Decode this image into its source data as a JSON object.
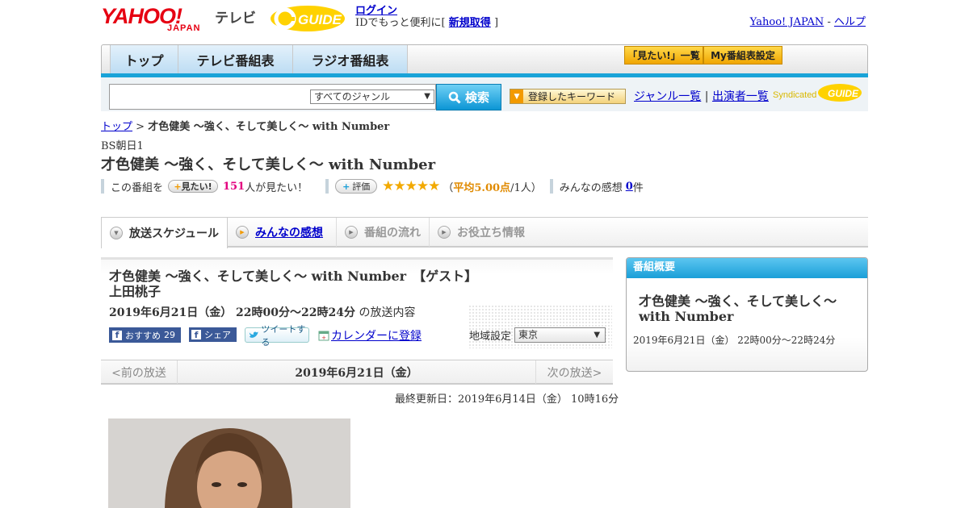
{
  "header": {
    "logo_yahoo": "YAHOO!",
    "logo_japan": "JAPAN",
    "logo_tv": "テレビ",
    "logo_gguide": "GUIDE",
    "login_link": "ログイン",
    "login_note_pre": "IDでもっと便利に[",
    "signup_link": "新規取得",
    "login_note_post": "]",
    "yahoo_japan_link": "Yahoo! JAPAN",
    "separator": "-",
    "help_link": "ヘルプ"
  },
  "nav": {
    "tabs": [
      {
        "label": "トップ"
      },
      {
        "label": "テレビ番組表"
      },
      {
        "label": "ラジオ番組表"
      }
    ],
    "mitai_list": "「見たい!」一覧",
    "my_schedule": "My番組表設定"
  },
  "search": {
    "genre_selected": "すべてのジャンル",
    "button": "検索",
    "keyword_button": "登録したキーワード",
    "genre_list": "ジャンル一覧",
    "link_sep": "|",
    "performers": "出演者一覧",
    "syndicated": "Syndicated"
  },
  "breadcrumb": {
    "top": "トップ",
    "sep": ">",
    "current": "才色健美 ～強く、そして美しく～ with Number"
  },
  "program": {
    "station": "BS朝日1",
    "title": "才色健美 ～強く、そして美しく～ with Number",
    "kono_bangumi": "この番組を",
    "mitai_button": "見たい!",
    "mitai_count": "151",
    "mitai_suffix": "人が見たい！",
    "hyoka_button": "評価",
    "stars": "★★★★★",
    "rating_open": "（",
    "rating_avg": "平均5.00点",
    "rating_count": "/1人）",
    "kansou_label": "みんなの感想",
    "kansou_count": "0",
    "kansou_suffix": "件"
  },
  "subtabs": [
    {
      "label": "放送スケジュール"
    },
    {
      "label": "みんなの感想"
    },
    {
      "label": "番組の流れ"
    },
    {
      "label": "お役立ち情報"
    }
  ],
  "broadcast": {
    "title": "才色健美 ～強く、そして美しく～ with Number　【ゲスト】上田桃子",
    "datetime": "2019年6月21日（金）  22時00分～22時24分",
    "datetime_suffix": "の放送内容",
    "fb_recommend": "おすすめ",
    "fb_recommend_count": "29",
    "fb_share": "シェア",
    "tweet": "ツイートする",
    "calendar": "カレンダーに登録",
    "region_label": "地域設定",
    "region_value": "東京",
    "prev": "<前の放送",
    "date": "2019年6月21日（金）",
    "next": "次の放送>",
    "updated": "最終更新日：2019年6月14日（金）  10時16分"
  },
  "sidebar": {
    "heading": "番組概要",
    "title": "才色健美 ～強く、そして美しく～ with Number",
    "time": "2019年6月21日（金）  22時00分～22時24分"
  },
  "colors": {
    "accent_blue": "#1aa3d8",
    "link": "#0000cc",
    "pink": "#e3007f",
    "orange": "#e08a00",
    "yahoo_red": "#e60012"
  }
}
